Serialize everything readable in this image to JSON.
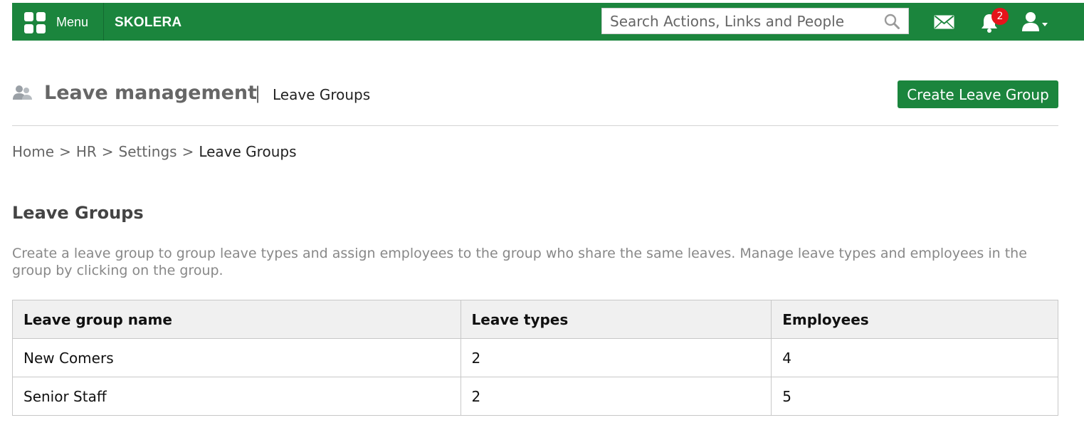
{
  "topbar": {
    "menu_label": "Menu",
    "brand": "SKOLERA",
    "search_placeholder": "Search Actions, Links and People",
    "notification_count": "2",
    "bar_color": "#1b853d",
    "badge_color": "#e5141b",
    "icons": [
      "menu-grid-icon",
      "search-icon",
      "mail-icon",
      "bell-icon",
      "user-icon",
      "caret-down-icon"
    ]
  },
  "header": {
    "title": "Leave management",
    "separator": "|",
    "subtitle": "Leave Groups",
    "create_button": "Create Leave Group",
    "title_icon": "users-icon"
  },
  "breadcrumb": {
    "separator": ">",
    "items": [
      "Home",
      "HR",
      "Settings"
    ],
    "current": "Leave Groups"
  },
  "section": {
    "title": "Leave Groups",
    "description": "Create a leave group to group leave types and assign employees to the group who share the same leaves. Manage leave types and employees in the group by clicking on the group."
  },
  "table": {
    "columns": [
      "Leave group name",
      "Leave types",
      "Employees"
    ],
    "rows": [
      [
        "New Comers",
        "2",
        "4"
      ],
      [
        "Senior Staff",
        "2",
        "5"
      ]
    ]
  }
}
